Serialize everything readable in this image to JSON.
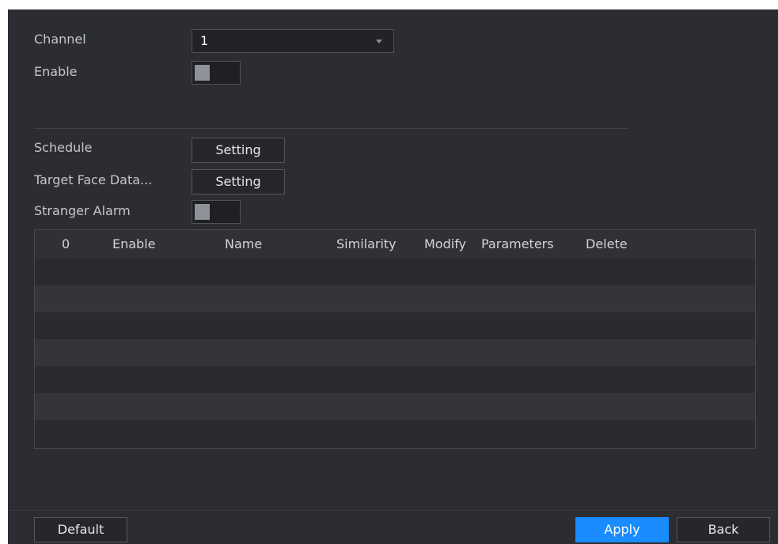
{
  "form": {
    "channel_label": "Channel",
    "channel_value": "1",
    "enable_label": "Enable",
    "schedule_label": "Schedule",
    "schedule_button": "Setting",
    "target_face_label": "Target Face Data...",
    "target_face_button": "Setting",
    "stranger_alarm_label": "Stranger Alarm"
  },
  "table": {
    "columns": [
      "0",
      "Enable",
      "Name",
      "Similarity",
      "Modify",
      "Parameters",
      "Delete"
    ],
    "rows": []
  },
  "footer": {
    "default_label": "Default",
    "apply_label": "Apply",
    "back_label": "Back"
  },
  "colors": {
    "panel_bg": "#2c2d32",
    "accent": "#1a8cff"
  }
}
